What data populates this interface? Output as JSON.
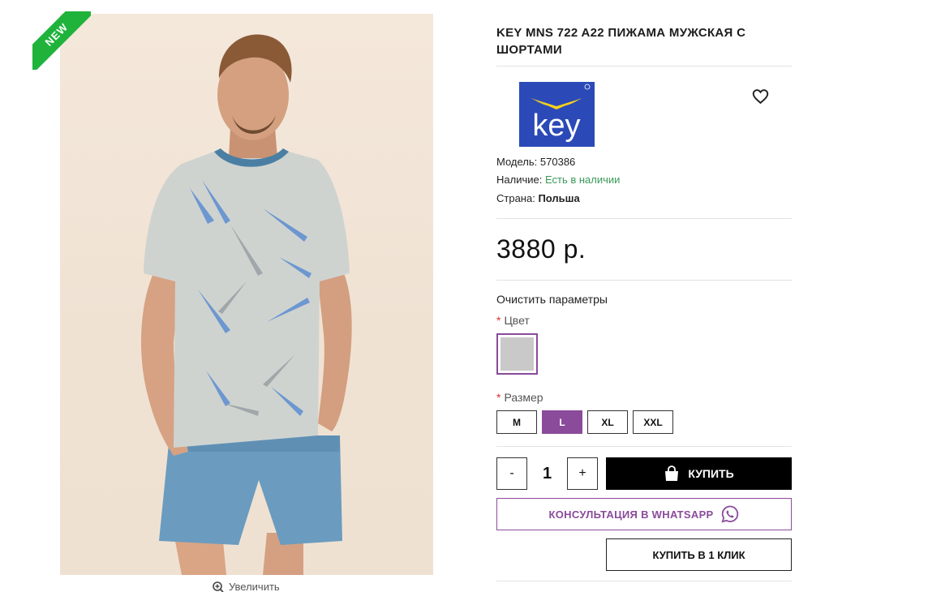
{
  "product": {
    "badge": "NEW",
    "title": "KEY MNS 722 A22 ПИЖАМА МУЖСКАЯ С ШОРТАМИ",
    "brand_logo_text": "key",
    "zoom_label": "Увеличить"
  },
  "details": {
    "model_label": "Модель:",
    "model_value": "570386",
    "availability_label": "Наличие:",
    "availability_value": "Есть в наличии",
    "country_label": "Страна:",
    "country_value": "Польша"
  },
  "price": "3880 р.",
  "options": {
    "clear_label": "Очистить параметры",
    "required_mark": "*",
    "color_label": "Цвет",
    "color_swatch": "#c9c9c9",
    "size_label": "Размер",
    "sizes": [
      "M",
      "L",
      "XL",
      "XXL"
    ],
    "selected_size": "L"
  },
  "cart": {
    "minus": "-",
    "quantity": "1",
    "plus": "+",
    "buy_label": "КУПИТЬ",
    "whatsapp_label": "КОНСУЛЬТАЦИЯ В WHATSAPP",
    "one_click_label": "КУПИТЬ В 1 КЛИК"
  },
  "colors": {
    "accent": "#8a4b9a",
    "badge": "#1fb33c",
    "in_stock": "#3a9a5a",
    "brand_blue": "#2b4ab8"
  }
}
